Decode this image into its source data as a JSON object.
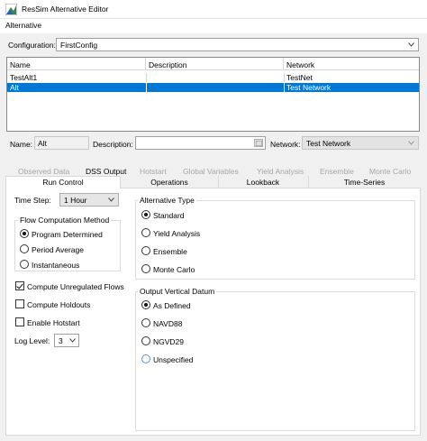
{
  "window": {
    "title": "ResSim Alternative Editor",
    "menu": [
      "Alternative"
    ]
  },
  "configuration": {
    "label": "Configuration:",
    "value": "FirstConfig"
  },
  "alt_table": {
    "columns": [
      "Name",
      "Description",
      "Network"
    ],
    "rows": [
      {
        "name": "TestAlt1",
        "description": "",
        "network": "TestNet"
      },
      {
        "name": "Alt",
        "description": "",
        "network": "Test Network",
        "selected": true
      }
    ]
  },
  "details": {
    "name_label": "Name:",
    "name_value": "Alt",
    "description_label": "Description:",
    "description_value": "",
    "network_label": "Network:",
    "network_value": "Test Network"
  },
  "tabs_row1": [
    {
      "label": "Observed Data",
      "enabled": false
    },
    {
      "label": "DSS Output",
      "enabled": true
    },
    {
      "label": "Hotstart",
      "enabled": false
    },
    {
      "label": "Global Variables",
      "enabled": false
    },
    {
      "label": "Yield Analysis",
      "enabled": false
    },
    {
      "label": "Ensemble",
      "enabled": false
    },
    {
      "label": "Monte Carlo",
      "enabled": false
    }
  ],
  "tabs_row2": [
    {
      "label": "Run Control",
      "active": true
    },
    {
      "label": "Operations"
    },
    {
      "label": "Lookback"
    },
    {
      "label": "Time-Series"
    }
  ],
  "run_control": {
    "time_step_label": "Time Step:",
    "time_step_value": "1 Hour",
    "flow_method": {
      "title": "Flow Computation Method",
      "options": [
        {
          "label": "Program Determined",
          "selected": true
        },
        {
          "label": "Period Average",
          "selected": false
        },
        {
          "label": "Instantaneous",
          "selected": false
        }
      ]
    },
    "checkboxes": [
      {
        "label": "Compute Unregulated Flows",
        "checked": true
      },
      {
        "label": "Compute Holdouts",
        "checked": false
      },
      {
        "label": "Enable Hotstart",
        "checked": false
      }
    ],
    "log_level_label": "Log Level:",
    "log_level_value": "3",
    "alt_type": {
      "title": "Alternative Type",
      "options": [
        {
          "label": "Standard",
          "selected": true
        },
        {
          "label": "Yield Analysis",
          "selected": false
        },
        {
          "label": "Ensemble",
          "selected": false
        },
        {
          "label": "Monte Carlo",
          "selected": false
        }
      ]
    },
    "datum": {
      "title": "Output Vertical Datum",
      "options": [
        {
          "label": "As Defined",
          "selected": true
        },
        {
          "label": "NAVD88",
          "selected": false
        },
        {
          "label": "NGVD29",
          "selected": false
        },
        {
          "label": "Unspecified",
          "selected": false
        }
      ]
    }
  },
  "colors": {
    "selection": "#0078d7",
    "disabled_text": "#a6a6a6",
    "focus_blue": "#5a9bd8"
  }
}
